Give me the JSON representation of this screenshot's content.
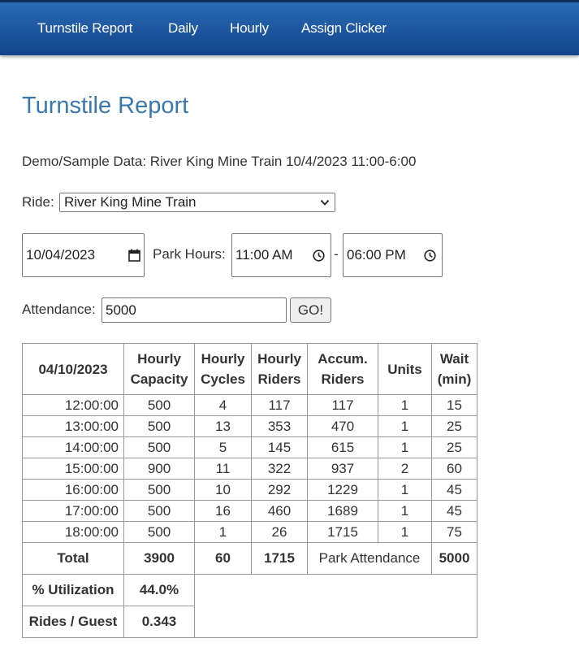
{
  "nav": {
    "items": [
      {
        "label": "Turnstile Report"
      },
      {
        "label": "Daily"
      },
      {
        "label": "Hourly"
      },
      {
        "label": "Assign Clicker"
      }
    ]
  },
  "page": {
    "title": "Turnstile Report",
    "demo_text": "Demo/Sample Data: River King Mine Train 10/4/2023 11:00-6:00"
  },
  "form": {
    "ride_label": "Ride:",
    "ride_value": "River King Mine Train",
    "date_value": "10/04/2023",
    "park_hours_label": "Park Hours:",
    "start_time": "11:00  AM",
    "time_separator": "-",
    "end_time": "06:00  PM",
    "attendance_label": "Attendance:",
    "attendance_value": "5000",
    "go_label": "GO!"
  },
  "table": {
    "date_header": "04/10/2023",
    "headers": {
      "capacity": [
        "Hourly",
        "Capacity"
      ],
      "cycles": [
        "Hourly",
        "Cycles"
      ],
      "riders": [
        "Hourly",
        "Riders"
      ],
      "accum": [
        "Accum.",
        "Riders"
      ],
      "units": "Units",
      "wait": [
        "Wait",
        "(min)"
      ]
    },
    "rows": [
      {
        "time": "12:00:00",
        "capacity": "500",
        "cycles": "4",
        "riders": "117",
        "accum": "117",
        "units": "1",
        "wait": "15"
      },
      {
        "time": "13:00:00",
        "capacity": "500",
        "cycles": "13",
        "riders": "353",
        "accum": "470",
        "units": "1",
        "wait": "25"
      },
      {
        "time": "14:00:00",
        "capacity": "500",
        "cycles": "5",
        "riders": "145",
        "accum": "615",
        "units": "1",
        "wait": "25"
      },
      {
        "time": "15:00:00",
        "capacity": "900",
        "cycles": "11",
        "riders": "322",
        "accum": "937",
        "units": "2",
        "wait": "60"
      },
      {
        "time": "16:00:00",
        "capacity": "500",
        "cycles": "10",
        "riders": "292",
        "accum": "1229",
        "units": "1",
        "wait": "45"
      },
      {
        "time": "17:00:00",
        "capacity": "500",
        "cycles": "16",
        "riders": "460",
        "accum": "1689",
        "units": "1",
        "wait": "45"
      },
      {
        "time": "18:00:00",
        "capacity": "500",
        "cycles": "1",
        "riders": "26",
        "accum": "1715",
        "units": "1",
        "wait": "75"
      }
    ],
    "total": {
      "label": "Total",
      "capacity": "3900",
      "cycles": "60",
      "riders": "1715",
      "park_attendance_label": "Park Attendance",
      "park_attendance": "5000"
    },
    "utilization": {
      "label": "% Utilization",
      "value": "44.0%"
    },
    "rides_per_guest": {
      "label": "Rides / Guest",
      "value": "0.343"
    }
  },
  "icons": {
    "calendar": "calendar-icon",
    "clock": "clock-icon",
    "dropdown": "chevron-down-icon"
  }
}
